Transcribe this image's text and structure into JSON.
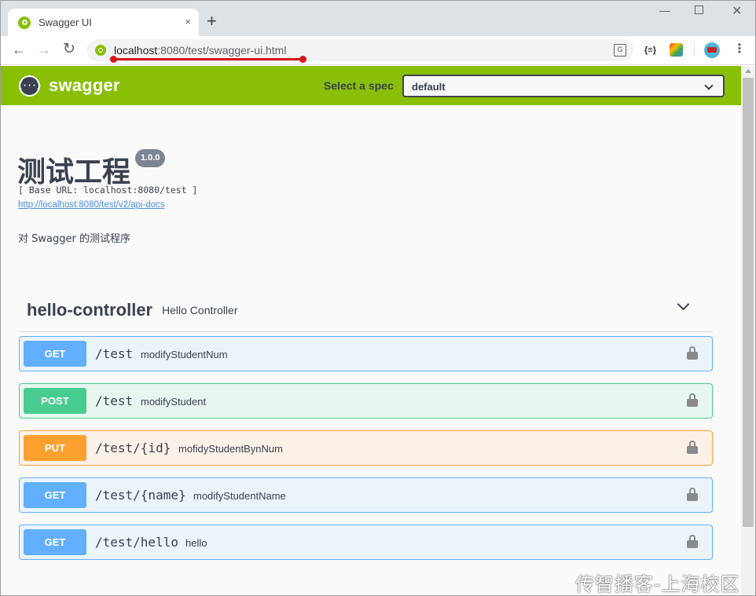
{
  "browser": {
    "tab_title": "Swagger UI",
    "tab_close": "×",
    "new_tab": "+",
    "url_host": "localhost",
    "url_path": ":8080/test/swagger-ui.html",
    "extensions": [
      "json-viewer-icon",
      "color-picker-icon",
      "avatar-icon",
      "menu-icon"
    ],
    "ext_json_label": "{≡}"
  },
  "swagger": {
    "logo_icon_text": "{···}",
    "logo_text": "swagger",
    "spec_label": "Select a spec",
    "spec_value": "default",
    "brand_color": "#89bf04"
  },
  "info": {
    "title": "测试工程",
    "version": "1.0.0",
    "base_url": "[ Base URL: localhost:8080/test ]",
    "api_docs_link": "http://localhost:8080/test/v2/api-docs",
    "description": "对 Swagger 的测试程序"
  },
  "tag": {
    "name": "hello-controller",
    "description": "Hello Controller"
  },
  "operations": [
    {
      "method": "GET",
      "path": "/test",
      "summary": "modifyStudentNum"
    },
    {
      "method": "POST",
      "path": "/test",
      "summary": "modifyStudent"
    },
    {
      "method": "PUT",
      "path": "/test/{id}",
      "summary": "mofidyStudentBynNum"
    },
    {
      "method": "GET",
      "path": "/test/{name}",
      "summary": "modifyStudentName"
    },
    {
      "method": "GET",
      "path": "/test/hello",
      "summary": "hello"
    }
  ],
  "watermark": "传智播客-上海校区"
}
